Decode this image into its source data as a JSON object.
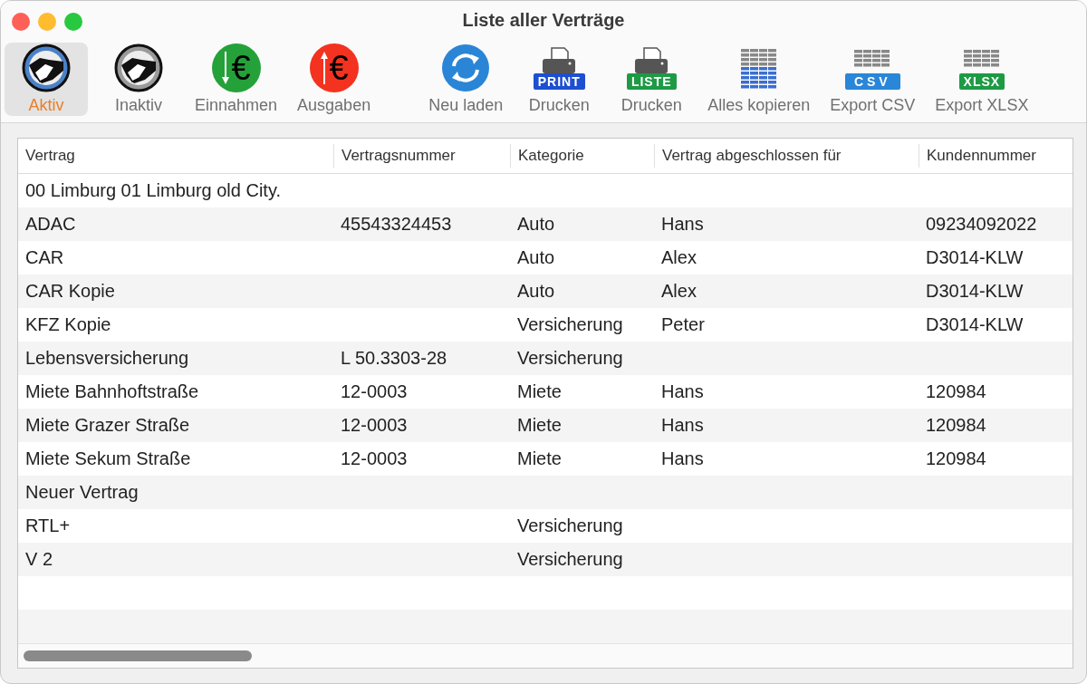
{
  "window": {
    "title": "Liste aller Verträge"
  },
  "toolbar": [
    {
      "kind": "handshake-blue",
      "label": "Aktiv",
      "selected": true
    },
    {
      "kind": "handshake-grey",
      "label": "Inaktiv",
      "selected": false
    },
    {
      "kind": "income",
      "label": "Einnahmen",
      "symbol": "€",
      "selected": false
    },
    {
      "kind": "expense",
      "label": "Ausgaben",
      "symbol": "€",
      "selected": false
    },
    {
      "kind": "reload",
      "label": "Neu laden",
      "selected": false
    },
    {
      "kind": "print",
      "label": "Drucken",
      "badge": "PRINT",
      "selected": false
    },
    {
      "kind": "print-list",
      "label": "Drucken",
      "badge": "LISTE",
      "selected": false
    },
    {
      "kind": "grid",
      "label": "Alles kopieren",
      "selected": false
    },
    {
      "kind": "csv",
      "label": "Export CSV",
      "badge": "CSV",
      "selected": false
    },
    {
      "kind": "xlsx",
      "label": "Export XLSX",
      "badge": "XLSX",
      "selected": false
    }
  ],
  "table": {
    "columns": [
      "Vertrag",
      "Vertragsnummer",
      "Kategorie",
      "Vertrag abgeschlossen für",
      "Kundennummer"
    ],
    "rows": [
      [
        "00 Limburg 01 Limburg old City.",
        "",
        "",
        "",
        ""
      ],
      [
        "ADAC",
        "45543324453",
        "Auto",
        "Hans",
        "09234092022"
      ],
      [
        "CAR",
        "",
        "Auto",
        "Alex",
        "D3014-KLW"
      ],
      [
        "CAR Kopie",
        "",
        "Auto",
        "Alex",
        "D3014-KLW"
      ],
      [
        "KFZ Kopie",
        "",
        "Versicherung",
        "Peter",
        "D3014-KLW"
      ],
      [
        "Lebensversicherung",
        "L 50.3303-28",
        "Versicherung",
        "",
        ""
      ],
      [
        "Miete Bahnhoftstraße",
        "12-0003",
        "Miete",
        "Hans",
        "120984"
      ],
      [
        "Miete Grazer Straße",
        "12-0003",
        "Miete",
        "Hans",
        "120984"
      ],
      [
        "Miete Sekum Straße",
        "12-0003",
        "Miete",
        "Hans",
        "120984"
      ],
      [
        "Neuer Vertrag",
        "",
        "",
        "",
        ""
      ],
      [
        "RTL+",
        "",
        "Versicherung",
        "",
        ""
      ],
      [
        "V 2",
        "",
        "Versicherung",
        "",
        ""
      ]
    ]
  }
}
